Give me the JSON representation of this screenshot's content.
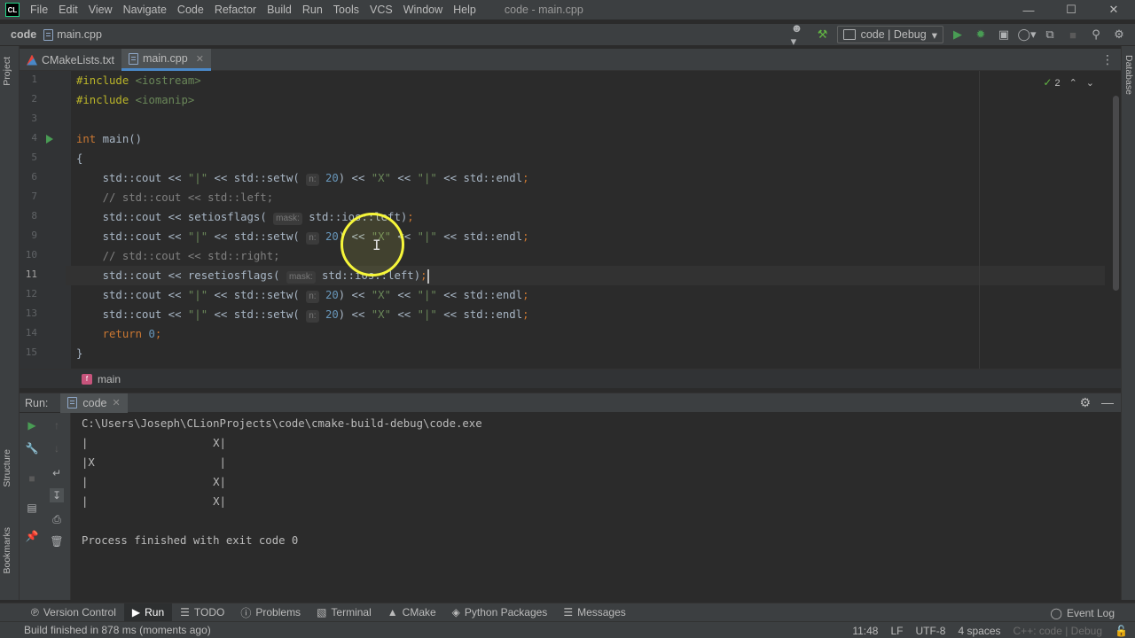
{
  "menubar": {
    "logo": "CL",
    "items": [
      "File",
      "Edit",
      "View",
      "Navigate",
      "Code",
      "Refactor",
      "Build",
      "Run",
      "Tools",
      "VCS",
      "Window",
      "Help"
    ],
    "title": "code - main.cpp"
  },
  "navbar": {
    "project": "code",
    "file": "main.cpp",
    "run_config": "code | Debug"
  },
  "side": {
    "left_top": "Project",
    "left_mid": "Structure",
    "left_bottom": "Bookmarks",
    "right": "Database"
  },
  "tabs": [
    {
      "label": "CMakeLists.txt"
    },
    {
      "label": "main.cpp"
    }
  ],
  "editor": {
    "line_numbers": [
      "1",
      "2",
      "3",
      "4",
      "5",
      "6",
      "7",
      "8",
      "9",
      "10",
      "11",
      "12",
      "13",
      "14",
      "15"
    ],
    "current_line": 11,
    "inspection_count": "2",
    "hint_n": "n:",
    "hint_mask": "mask:",
    "line1": {
      "dir": "#include",
      "hdr": "<iostream>"
    },
    "line2": {
      "dir": "#include",
      "hdr": "<iomanip>"
    },
    "line4": {
      "kw": "int",
      "rest": " main()"
    },
    "line5": "{",
    "setw_num": "20",
    "cout": "std::cout",
    "shl": " << ",
    "bar": "\"|\"",
    "xstr": "\"X\"",
    "setw": "std::setw(",
    "endl": "std::endl",
    "comment_left": "// std::cout << std::left;",
    "comment_right": "// std::cout << std::right;",
    "setiosflags": "setiosflags(",
    "resetiosflags": "resetiosflags(",
    "ios_left": "std::ios::left",
    "return_kw": "return",
    "return_val": "0",
    "line15": "}"
  },
  "breadcrumb": {
    "icon": "f",
    "function": "main"
  },
  "run_panel": {
    "label": "Run:",
    "tab": "code",
    "output": [
      "C:\\Users\\Joseph\\CLionProjects\\code\\cmake-build-debug\\code.exe",
      "|                   X|",
      "|X                   |",
      "|                   X|",
      "|                   X|",
      "",
      "Process finished with exit code 0"
    ]
  },
  "toolwindows": {
    "items": [
      "Version Control",
      "Run",
      "TODO",
      "Problems",
      "Terminal",
      "CMake",
      "Python Packages",
      "Messages"
    ],
    "event_log": "Event Log"
  },
  "status": {
    "message": "Build finished in 878 ms (moments ago)",
    "position": "11:48",
    "line_sep": "LF",
    "encoding": "UTF-8",
    "indent": "4 spaces",
    "context": "C++: code | Debug"
  },
  "colors": {
    "accent": "#4a88c7",
    "run_green": "#499c54",
    "cursor_ring": "#f6f63a"
  }
}
